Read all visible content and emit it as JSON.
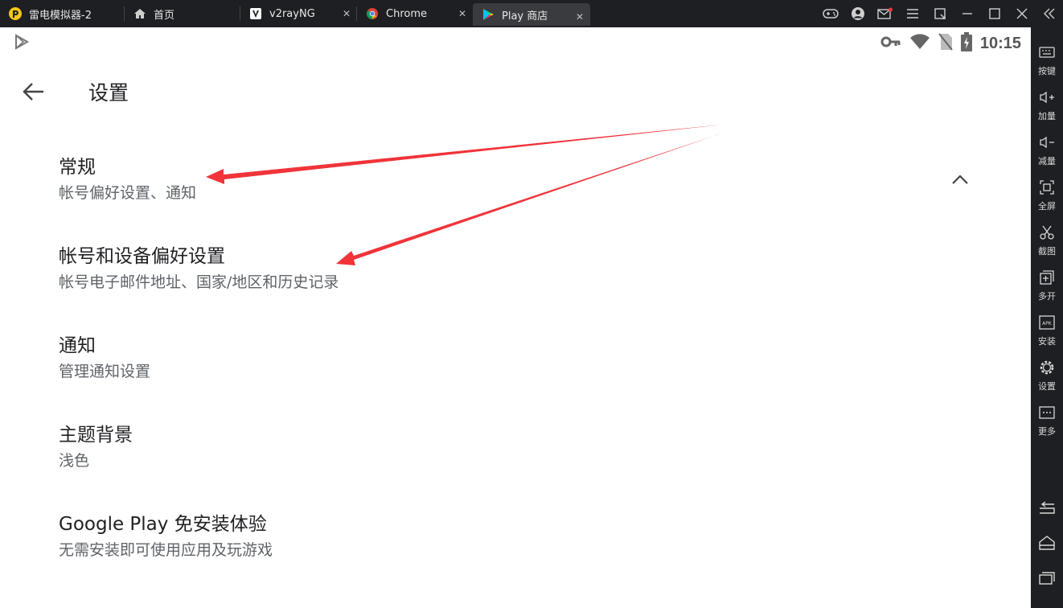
{
  "window": {
    "tabs": [
      {
        "label": "雷电模拟器-2",
        "icon": "leidian-logo-icon"
      },
      {
        "label": "首页",
        "icon": "home-icon"
      },
      {
        "label": "v2rayNG",
        "icon": "v2rayng-icon"
      },
      {
        "label": "Chrome",
        "icon": "chrome-icon"
      },
      {
        "label": "Play 商店",
        "icon": "play-store-icon"
      }
    ],
    "active_tab": 4
  },
  "status_bar": {
    "time": "10:15"
  },
  "page": {
    "title": "设置"
  },
  "settings": [
    {
      "title": "常规",
      "subtitle": "帐号偏好设置、通知"
    },
    {
      "title": "帐号和设备偏好设置",
      "subtitle": "帐号电子邮件地址、国家/地区和历史记录"
    },
    {
      "title": "通知",
      "subtitle": "管理通知设置"
    },
    {
      "title": "主题背景",
      "subtitle": "浅色"
    },
    {
      "title": "Google Play 免安装体验",
      "subtitle": "无需安装即可使用应用及玩游戏"
    }
  ],
  "sidebar": [
    {
      "label": "按键",
      "icon": "keyboard-icon"
    },
    {
      "label": "加量",
      "icon": "volume-up-icon"
    },
    {
      "label": "减量",
      "icon": "volume-down-icon"
    },
    {
      "label": "全屏",
      "icon": "fullscreen-icon"
    },
    {
      "label": "截图",
      "icon": "scissors-icon"
    },
    {
      "label": "多开",
      "icon": "multi-instance-icon"
    },
    {
      "label": "安装",
      "icon": "apk-install-icon"
    },
    {
      "label": "设置",
      "icon": "gear-icon"
    },
    {
      "label": "更多",
      "icon": "more-icon"
    }
  ],
  "colors": {
    "annotation_arrow": "#f0343a",
    "accent_yellow": "#f5c518"
  }
}
